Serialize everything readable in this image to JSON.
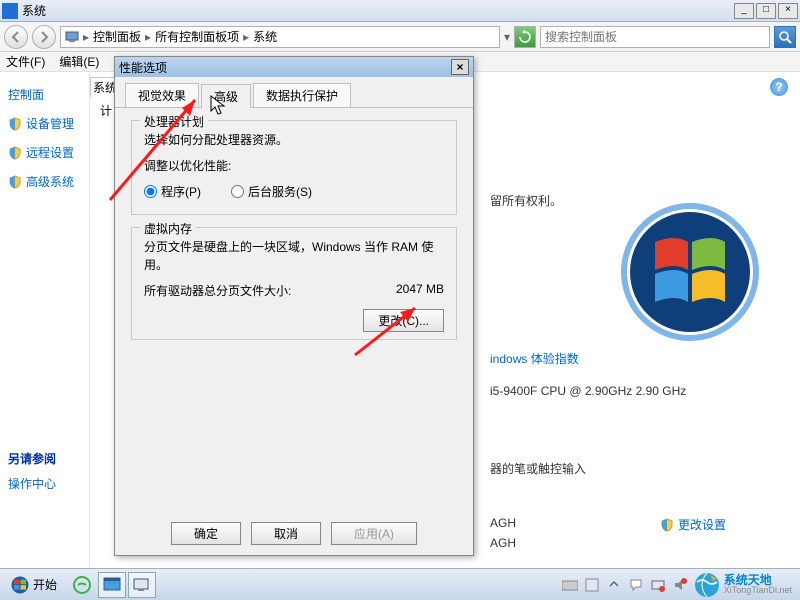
{
  "window": {
    "title": "系统"
  },
  "nav": {
    "crumb1": "控制面板",
    "crumb2": "所有控制面板项",
    "crumb3": "系统",
    "search_placeholder": "搜索控制面板"
  },
  "menu": {
    "file": "文件(F)",
    "edit": "编辑(E)"
  },
  "left": {
    "home": "控制面",
    "devmgr": "设备管理",
    "remote": "远程设置",
    "advsys": "高级系统",
    "see_also": "另请参阅",
    "action_center": "操作中心"
  },
  "behind": {
    "tab": "系统",
    "label": "计"
  },
  "right": {
    "copyright": "留所有权利。",
    "wei": "indows 体验指数",
    "cpu": "i5-9400F CPU @ 2.90GHz   2.90 GHz",
    "pen": "器的笔或触控输入",
    "agh1": "AGH",
    "agh2": "AGH",
    "change": "更改设置"
  },
  "dialog": {
    "title": "性能选项",
    "tabs": {
      "visual": "视觉效果",
      "advanced": "高级",
      "dep": "数据执行保护"
    },
    "sched": {
      "legend": "处理器计划",
      "desc": "选择如何分配处理器资源。",
      "adjust": "调整以优化性能:",
      "programs": "程序(P)",
      "services": "后台服务(S)"
    },
    "vm": {
      "legend": "虚拟内存",
      "desc": "分页文件是硬盘上的一块区域，Windows 当作 RAM 使用。",
      "total_label": "所有驱动器总分页文件大小:",
      "total_value": "2047 MB",
      "change": "更改(C)..."
    },
    "ok": "确定",
    "cancel": "取消",
    "apply": "应用(A)"
  },
  "taskbar": {
    "start": "开始",
    "brand_cn": "系统天地",
    "brand_url": "XiTongTianDi.net"
  }
}
